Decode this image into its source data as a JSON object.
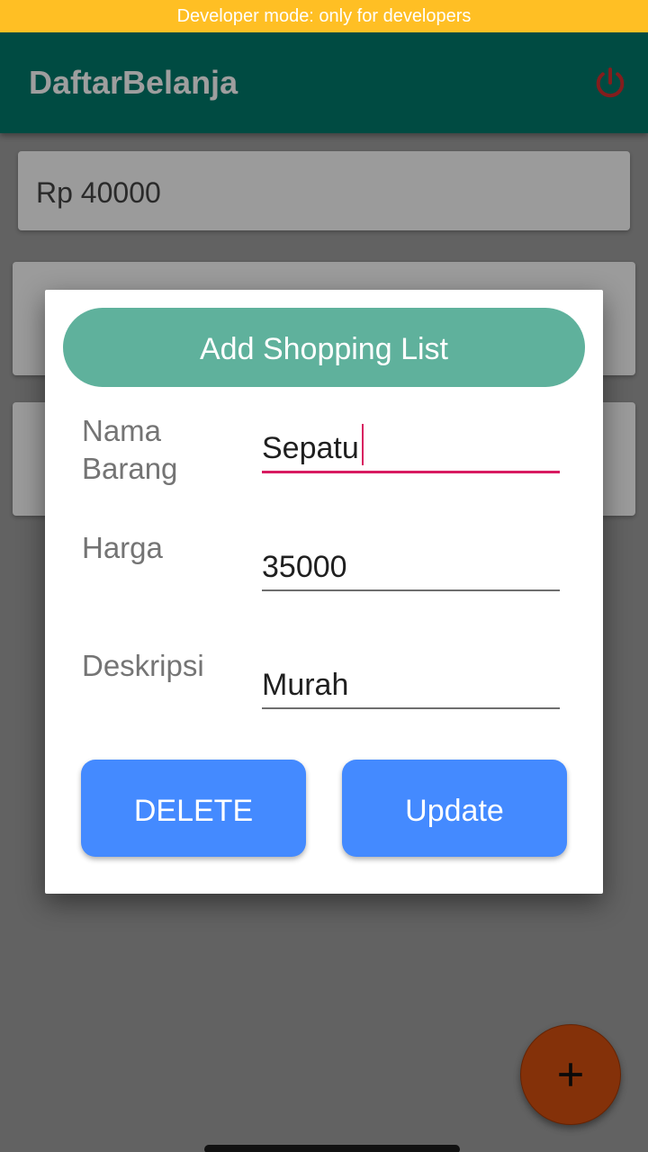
{
  "status_banner": {
    "text": "Developer mode: only for developers",
    "color": "#ffbf24"
  },
  "app_bar": {
    "title": "DaftarBelanja",
    "background": "#00796b",
    "power_icon": "power-icon",
    "power_icon_color": "#d32f2f"
  },
  "list": {
    "total": "Rp 40000"
  },
  "dialog": {
    "header": "Add Shopping List",
    "header_color": "#5fb19c",
    "fields": {
      "name": {
        "label": "Nama\nBarang",
        "value": "Sepatu"
      },
      "price": {
        "label": "Harga",
        "value": "35000"
      },
      "description": {
        "label": "Deskripsi",
        "value": "Murah"
      }
    },
    "buttons": {
      "delete": "DELETE",
      "update": "Update"
    },
    "button_color": "#448aff"
  },
  "fab": {
    "icon": "plus-icon",
    "color": "#d64f0f"
  }
}
